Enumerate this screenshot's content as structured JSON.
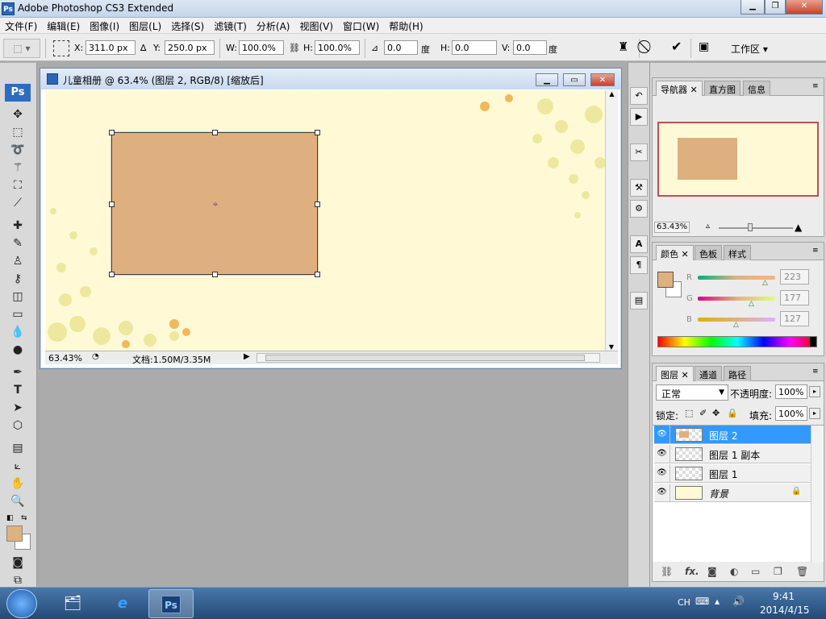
{
  "app": {
    "title": "Adobe Photoshop CS3 Extended",
    "logo": "Ps"
  },
  "menu": [
    "文件(F)",
    "编辑(E)",
    "图像(I)",
    "图层(L)",
    "选择(S)",
    "滤镜(T)",
    "分析(A)",
    "视图(V)",
    "窗口(W)",
    "帮助(H)"
  ],
  "options": {
    "x_label": "X:",
    "x_value": "311.0 px",
    "y_label": "Y:",
    "y_value": "250.0 px",
    "w_label": "W:",
    "w_value": "100.0%",
    "h_label": "H:",
    "h_value": "100.0%",
    "angle_value": "0.0",
    "deg1": "度",
    "hs_label": "H:",
    "hs_value": "0.0",
    "deg2": "度",
    "vs_label": "V:",
    "vs_value": "0.0",
    "deg3": "度",
    "workspace_label": "工作区"
  },
  "document": {
    "title": "儿童相册 @ 63.4% (图层 2, RGB/8) [缩放后]",
    "zoom": "63.43%",
    "doc_info": "文档:1.50M/3.35M",
    "rect_color": "#deb07f",
    "bg_color": "#fff9d6"
  },
  "navigator": {
    "tabs": [
      "导航器",
      "直方图",
      "信息"
    ],
    "zoom": "63.43%"
  },
  "color_panel": {
    "tabs": [
      "颜色",
      "色板",
      "样式"
    ],
    "r_label": "R",
    "g_label": "G",
    "b_label": "B",
    "r": "223",
    "g": "177",
    "b": "127",
    "fg_color": "#dfb17f"
  },
  "layers_panel": {
    "tabs": [
      "图层",
      "通道",
      "路径"
    ],
    "blend_mode": "正常",
    "opacity_label": "不透明度:",
    "opacity": "100%",
    "lock_label": "锁定:",
    "fill_label": "填充:",
    "fill": "100%",
    "layers": [
      {
        "name": "图层 2",
        "selected": true
      },
      {
        "name": "图层 1 副本",
        "selected": false
      },
      {
        "name": "图层 1",
        "selected": false
      },
      {
        "name": "背景",
        "selected": false
      }
    ]
  },
  "taskbar": {
    "lang": "CH",
    "time": "9:41",
    "date": "2014/4/15",
    "ps_label": "Ps"
  }
}
